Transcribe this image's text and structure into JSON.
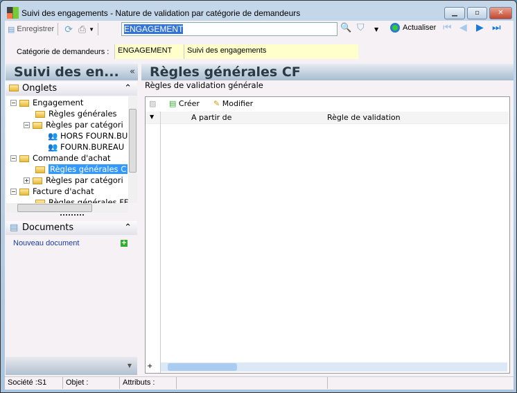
{
  "window": {
    "title": "Suivi des engagements -  Nature de validation par catégorie de demandeurs"
  },
  "toolbar": {
    "save_label": "Enregistrer",
    "search_value": "ENGAGEMENT",
    "refresh_label": "Actualiser"
  },
  "category": {
    "label": "Catégorie de demandeurs :",
    "code": "ENGAGEMENT",
    "description": "Suivi des engagements"
  },
  "sidebar": {
    "title": "Suivi des en...",
    "tabs_header": "Onglets",
    "tree": [
      {
        "label": "Engagement"
      },
      {
        "label": "Règles générales"
      },
      {
        "label": "Règles par catégori"
      },
      {
        "label": "HORS FOURN.BU"
      },
      {
        "label": "FOURN.BUREAU"
      },
      {
        "label": "Commande d'achat"
      },
      {
        "label": "Règles générales C"
      },
      {
        "label": "Règles par catégori"
      },
      {
        "label": "Facture d'achat"
      },
      {
        "label": "Règles générales FF"
      }
    ],
    "documents_header": "Documents",
    "new_document": "Nouveau document"
  },
  "main": {
    "title": "Règles générales CF",
    "group": "Règles de validation générale",
    "create_label": "Créer",
    "edit_label": "Modifier",
    "columns": [
      "A partir de",
      "Règle de validation"
    ]
  },
  "status": {
    "company": "Société :S1",
    "object": "Objet :",
    "attributes": "Attributs :"
  }
}
